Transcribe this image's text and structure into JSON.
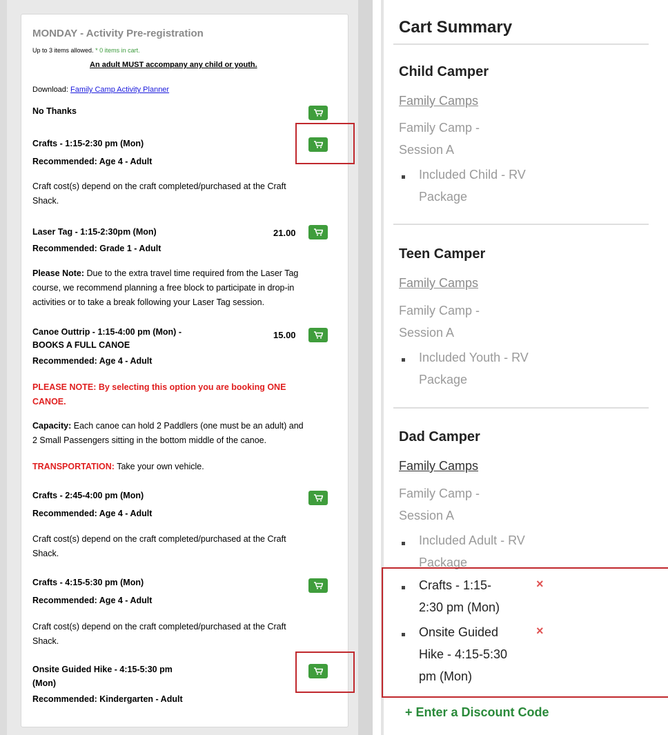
{
  "left": {
    "title": "MONDAY - Activity Pre-registration",
    "limit_text": "Up to 3 items allowed.",
    "cart_count": "* 0 items in cart.",
    "adult_notice": "An adult MUST accompany any child or youth.",
    "download_label": "Download:",
    "download_link": "Family Camp Activity Planner",
    "items": {
      "no_thanks": "No Thanks",
      "crafts1_name": "Crafts - 1:15-2:30 pm (Mon)",
      "crafts1_rec": "Recommended: Age 4 - Adult",
      "crafts1_desc_1": "Craft cost(s) depend on the craft completed/purchased at the Craft",
      "crafts1_desc_2": "Shack.",
      "laser_name": "Laser Tag - 1:15-2:30pm (Mon)",
      "laser_price": "21.00",
      "laser_rec": "Recommended: Grade 1 - Adult",
      "laser_note_label": "Please Note:",
      "laser_note_1": " Due to the extra travel time required from the Laser Tag",
      "laser_note_2": "course, we recommend planning a free block to participate in drop-in",
      "laser_note_3": "activities or to take a break following your Laser Tag session.",
      "canoe_name_1": "Canoe Outtrip - 1:15-4:00 pm (Mon) -",
      "canoe_name_2": "BOOKS A FULL CANOE",
      "canoe_price": "15.00",
      "canoe_rec": "Recommended: Age 4 - Adult",
      "canoe_warn_1": "PLEASE NOTE: By selecting this option you are booking ONE",
      "canoe_warn_2": "CANOE.",
      "capacity_label": "Capacity:",
      "capacity_1": " Each canoe can hold 2 Paddlers (one must be an adult) and",
      "capacity_2": "2 Small Passengers sitting in the bottom middle of the canoe.",
      "transport_label": "TRANSPORTATION:",
      "transport_text": " Take your own vehicle.",
      "crafts2_name": "Crafts - 2:45-4:00 pm (Mon)",
      "crafts2_rec": "Recommended: Age 4 - Adult",
      "crafts2_desc_1": "Craft cost(s) depend on the craft completed/purchased at the Craft",
      "crafts2_desc_2": "Shack.",
      "crafts3_name": "Crafts - 4:15-5:30 pm (Mon)",
      "crafts3_rec": "Recommended: Age 4 - Adult",
      "crafts3_desc_1": "Craft cost(s) depend on the craft completed/purchased at the Craft",
      "crafts3_desc_2": "Shack.",
      "hike_name_1": "Onsite Guided Hike - 4:15-5:30 pm",
      "hike_name_2": "(Mon)",
      "hike_rec": "Recommended: Kindergarten - Adult"
    }
  },
  "cart": {
    "title": "Cart Summary",
    "child": {
      "heading": "Child Camper",
      "program": "Family Camps",
      "session_1": "Family Camp -",
      "session_2": "Session A",
      "pkg_1": "Included Child - RV",
      "pkg_2": "Package"
    },
    "teen": {
      "heading": "Teen Camper",
      "program": "Family Camps",
      "session_1": "Family Camp -",
      "session_2": "Session A",
      "pkg_1": "Included Youth - RV",
      "pkg_2": "Package"
    },
    "dad": {
      "heading": "Dad Camper",
      "program": "Family Camps",
      "session_1": "Family Camp -",
      "session_2": "Session A",
      "pkg_1": "Included Adult - RV",
      "pkg_2": "Package",
      "act1_1": "Crafts - 1:15-",
      "act1_2": "2:30 pm (Mon)",
      "act2_1": "Onsite Guided",
      "act2_2": "Hike - 4:15-5:30",
      "act2_3": "pm (Mon)",
      "remove_symbol": "×"
    },
    "discount": "+ Enter a Discount Code"
  },
  "colors": {
    "button_green": "#3f9d3c",
    "highlight_red": "#c0282d",
    "warning_red": "#e02020",
    "discount_green": "#2a8a3a"
  }
}
